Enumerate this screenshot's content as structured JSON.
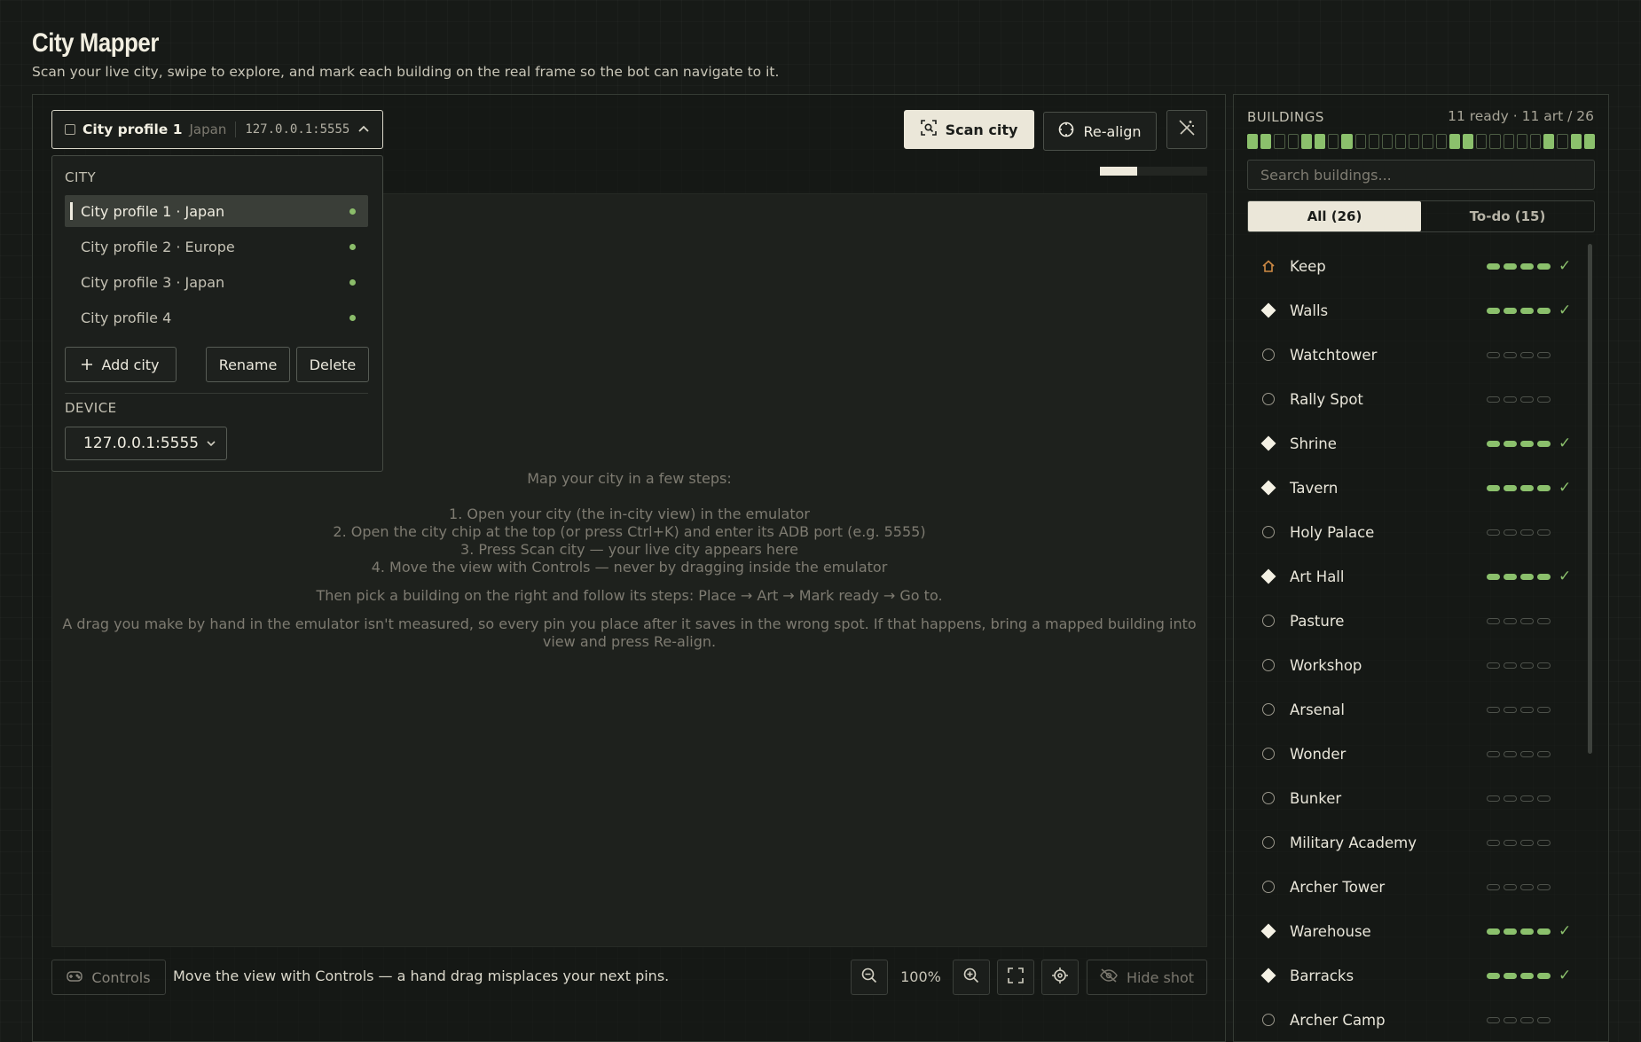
{
  "app": {
    "title": "City Mapper",
    "subtitle": "Scan your live city, swipe to explore, and mark each building on the real frame so the bot can navigate to it."
  },
  "profile_chip": {
    "name": "City profile 1",
    "region": "Japan",
    "address": "127.0.0.1:5555"
  },
  "toolbar": {
    "scan_label": "Scan city",
    "realign_label": "Re-align"
  },
  "scan_progress": {
    "fraction": 0.35
  },
  "dropdown": {
    "city_label": "CITY",
    "cities": [
      {
        "label": "City profile 1 · Japan",
        "active": true
      },
      {
        "label": "City profile 2 · Europe",
        "active": false
      },
      {
        "label": "City profile 3 · Japan",
        "active": false
      },
      {
        "label": "City profile 4",
        "active": false
      }
    ],
    "add_label": "Add city",
    "rename_label": "Rename",
    "delete_label": "Delete",
    "device_label": "DEVICE",
    "device_value": "127.0.0.1:5555"
  },
  "instructions": {
    "intro": "Map your city in a few steps:",
    "steps": [
      "1.  Open your city (the in-city view) in the emulator",
      "2.  Open the city chip at the top (or press Ctrl+K) and enter its ADB port  (e.g. 5555)",
      "3.  Press  Scan city  —  your live city appears here",
      "4.  Move the view with  Controls  —  never by dragging inside the emulator"
    ],
    "then": "Then pick a building on the right and follow its steps: Place → Art → Mark ready → Go to.",
    "warning": "A drag you make by hand in the emulator isn't measured, so every pin you place after it saves in the wrong spot. If that happens, bring a mapped building into view and press Re-align."
  },
  "bottom_bar": {
    "controls_label": "Controls",
    "hint": "Move the view with Controls — a hand drag misplaces your next pins.",
    "zoom": "100%",
    "hide_label": "Hide shot"
  },
  "buildings": {
    "label": "BUILDINGS",
    "stats": "11 ready · 11 art / 26",
    "segments": [
      1,
      1,
      0,
      0,
      1,
      1,
      0,
      1,
      0,
      0,
      0,
      0,
      0,
      0,
      0,
      1,
      1,
      0,
      0,
      0,
      0,
      0,
      1,
      0,
      1,
      1
    ],
    "search_placeholder": "Search buildings...",
    "tab_all": "All (26)",
    "tab_todo": "To-do (15)",
    "items": [
      {
        "name": "Keep",
        "icon": "home",
        "steps": 4,
        "done": true
      },
      {
        "name": "Walls",
        "icon": "diamond",
        "steps": 4,
        "done": true
      },
      {
        "name": "Watchtower",
        "icon": "ring",
        "steps": 0,
        "done": false
      },
      {
        "name": "Rally Spot",
        "icon": "ring",
        "steps": 0,
        "done": false
      },
      {
        "name": "Shrine",
        "icon": "diamond",
        "steps": 4,
        "done": true
      },
      {
        "name": "Tavern",
        "icon": "diamond",
        "steps": 4,
        "done": true
      },
      {
        "name": "Holy Palace",
        "icon": "ring",
        "steps": 0,
        "done": false
      },
      {
        "name": "Art Hall",
        "icon": "diamond",
        "steps": 4,
        "done": true
      },
      {
        "name": "Pasture",
        "icon": "ring",
        "steps": 0,
        "done": false
      },
      {
        "name": "Workshop",
        "icon": "ring",
        "steps": 0,
        "done": false
      },
      {
        "name": "Arsenal",
        "icon": "ring",
        "steps": 0,
        "done": false
      },
      {
        "name": "Wonder",
        "icon": "ring",
        "steps": 0,
        "done": false
      },
      {
        "name": "Bunker",
        "icon": "ring",
        "steps": 0,
        "done": false
      },
      {
        "name": "Military Academy",
        "icon": "ring",
        "steps": 0,
        "done": false
      },
      {
        "name": "Archer Tower",
        "icon": "ring",
        "steps": 0,
        "done": false
      },
      {
        "name": "Warehouse",
        "icon": "diamond",
        "steps": 4,
        "done": true
      },
      {
        "name": "Barracks",
        "icon": "diamond",
        "steps": 4,
        "done": true
      },
      {
        "name": "Archer Camp",
        "icon": "ring",
        "steps": 0,
        "done": false
      }
    ]
  }
}
